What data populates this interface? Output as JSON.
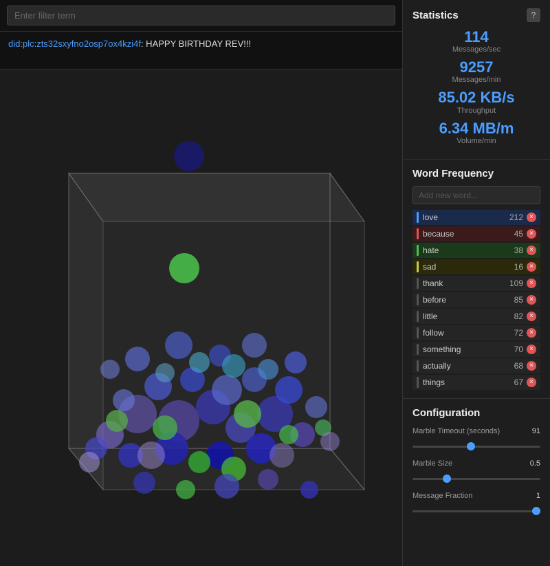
{
  "filter": {
    "placeholder": "Enter filter term",
    "value": ""
  },
  "message": {
    "did_link": "did:plc:zts32sxyfno2osp7ox4kzi4f",
    "text": ": HAPPY BIRTHDAY REV!!!"
  },
  "stats": {
    "title": "Statistics",
    "help_label": "?",
    "items": [
      {
        "value": "114",
        "label": "Messages/sec"
      },
      {
        "value": "9257",
        "label": "Messages/min"
      },
      {
        "value": "85.02 KB/s",
        "label": "Throughput"
      },
      {
        "value": "6.34 MB/m",
        "label": "Volume/min"
      }
    ]
  },
  "word_frequency": {
    "title": "Word Frequency",
    "add_placeholder": "Add new word...",
    "words": [
      {
        "name": "love",
        "count": "212",
        "color": "#4a9eff",
        "highlight": "highlight-blue"
      },
      {
        "name": "because",
        "count": "45",
        "color": "#e05555",
        "highlight": "highlight-red"
      },
      {
        "name": "hate",
        "count": "38",
        "color": "#55bb55",
        "highlight": "highlight-green"
      },
      {
        "name": "sad",
        "count": "16",
        "color": "#cccc44",
        "highlight": "highlight-yellow"
      },
      {
        "name": "thank",
        "count": "109",
        "color": "#555",
        "highlight": ""
      },
      {
        "name": "before",
        "count": "85",
        "color": "#555",
        "highlight": ""
      },
      {
        "name": "little",
        "count": "82",
        "color": "#555",
        "highlight": ""
      },
      {
        "name": "follow",
        "count": "72",
        "color": "#555",
        "highlight": ""
      },
      {
        "name": "something",
        "count": "70",
        "color": "#555",
        "highlight": ""
      },
      {
        "name": "actually",
        "count": "68",
        "color": "#555",
        "highlight": ""
      },
      {
        "name": "things",
        "count": "67",
        "color": "#555",
        "highlight": ""
      }
    ]
  },
  "configuration": {
    "title": "Configuration",
    "sliders": [
      {
        "label": "Marble Timeout (seconds)",
        "value": "91",
        "min": 0,
        "max": 200,
        "current": 91
      },
      {
        "label": "Marble Size",
        "value": "0.5",
        "min": 0,
        "max": 2,
        "current": 0.5
      },
      {
        "label": "Message Fraction",
        "value": "1",
        "min": 0,
        "max": 1,
        "current": 1
      }
    ]
  }
}
